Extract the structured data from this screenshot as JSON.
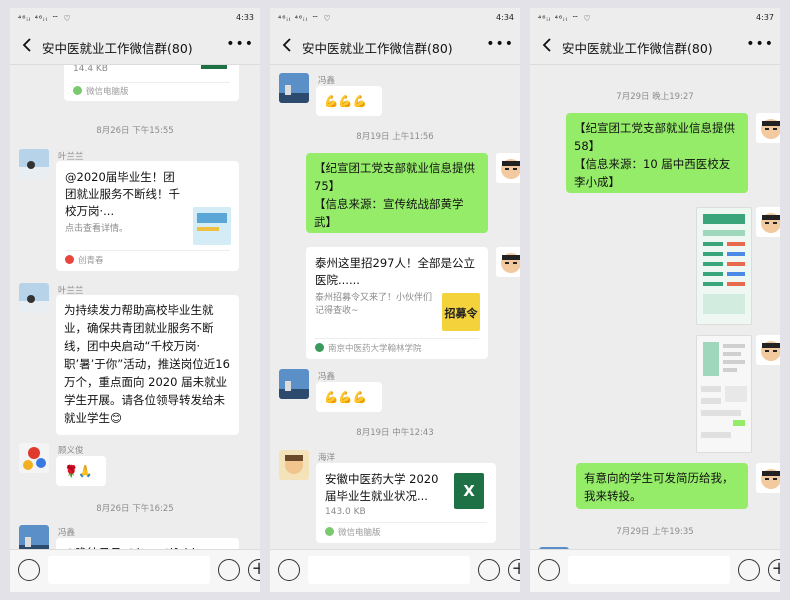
{
  "phones": [
    {
      "status": {
        "time": "4:33",
        "left": "⁴⁶ᵢₗ ⁴⁶ᵢₗ ⌔ ♡"
      },
      "title": "安中医就业工作微信群(80)",
      "messages": {
        "file_size": "14.4 KB",
        "file_source": "微信电脑版",
        "ts1": "8月26日 下午15:55",
        "sender1": "叶兰兰",
        "card_title": "@2020届毕业生！团团就业服务不断线！千校万岗·...",
        "card_desc": "点击查看详情。",
        "card_source": "创青春",
        "sender2": "叶兰兰",
        "long_text": "为持续发力帮助高校毕业生就业，确保共青团就业服务不断线，团中央启动“千校万岗·职’暑’于你”活动，推送岗位近16万个，重点面向 2020 届未就业学生开展。请各位领导转发给未就业学生😊",
        "sender3": "顾义俊",
        "emoji_msg": "🌹🙏",
        "ts2": "8月26日 下午16:25",
        "sender4": "冯鑫",
        "partial_text": "@瞻彼日月 @beautifulday-gu"
      }
    },
    {
      "status": {
        "time": "4:34",
        "left": "⁴⁶ᵢₗ ⁴⁶ᵢₗ ⌔ ♡"
      },
      "title": "安中医就业工作微信群(80)",
      "messages": {
        "sender1": "冯鑫",
        "muscle1": "💪💪💪",
        "ts1": "8月19日 上午11:56",
        "green_text": "【纪宣团工党支部就业信息提供75】\n【信息来源：宣传统战部黄学武】",
        "card_title": "泰州这里招297人！全部是公立医院......",
        "card_desc": "泰州招募令又来了！小伙伴们记得查收~",
        "card_source": "南京中医药大学翰林学院",
        "thumb_text": "招募令",
        "sender2": "冯鑫",
        "muscle2": "💪💪💪",
        "ts2": "8月19日 中午12:43",
        "sender3": "海洋",
        "file_title": "安徽中医药大学 2020 届毕业生就业状况...",
        "file_size": "143.0 KB",
        "file_source": "微信电脑版",
        "excel_letter": "X"
      }
    },
    {
      "status": {
        "time": "4:37",
        "left": "⁴⁶ᵢₗ ⁴⁶ᵢₗ ⌔ ♡"
      },
      "title": "安中医就业工作微信群(80)",
      "messages": {
        "ts1": "7月29日 晚上19:27",
        "green_text1": "【纪宣团工党支部就业信息提供58】\n【信息来源：10 届中西医校友李小成】",
        "green_text2": "有意向的学生可发简历给我，我来转投。",
        "ts2": "7月29日 上午19:35"
      }
    }
  ],
  "colors": {
    "bubble_green": "#95ec69",
    "chat_bg": "#ededed",
    "excel_green": "#1e7145"
  },
  "icons": [
    "back-arrow-icon",
    "more-icon",
    "voice-icon",
    "emoji-icon",
    "plus-icon",
    "file-icon",
    "excel-icon"
  ]
}
